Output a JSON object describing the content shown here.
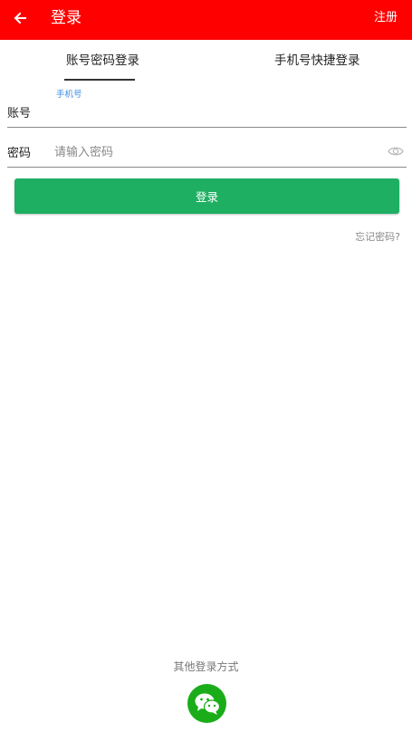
{
  "appbar": {
    "title": "登录",
    "register_label": "注册",
    "background": "#ff0000",
    "back_icon": "arrow-left-icon"
  },
  "tabs": [
    {
      "label": "账号密码登录",
      "active": true
    },
    {
      "label": "手机号快捷登录",
      "active": false
    }
  ],
  "form": {
    "account_hint": "手机号",
    "account_label": "账号",
    "account_value": "",
    "password_label": "密码",
    "password_placeholder": "请输入密码",
    "password_toggle_icon": "eye-icon",
    "login_button": "登录",
    "login_button_color": "#1faf62",
    "forgot_password": "忘记密码?"
  },
  "footer": {
    "other_login_label": "其他登录方式",
    "wechat_icon": "wechat-icon",
    "wechat_color": "#1aad19"
  }
}
